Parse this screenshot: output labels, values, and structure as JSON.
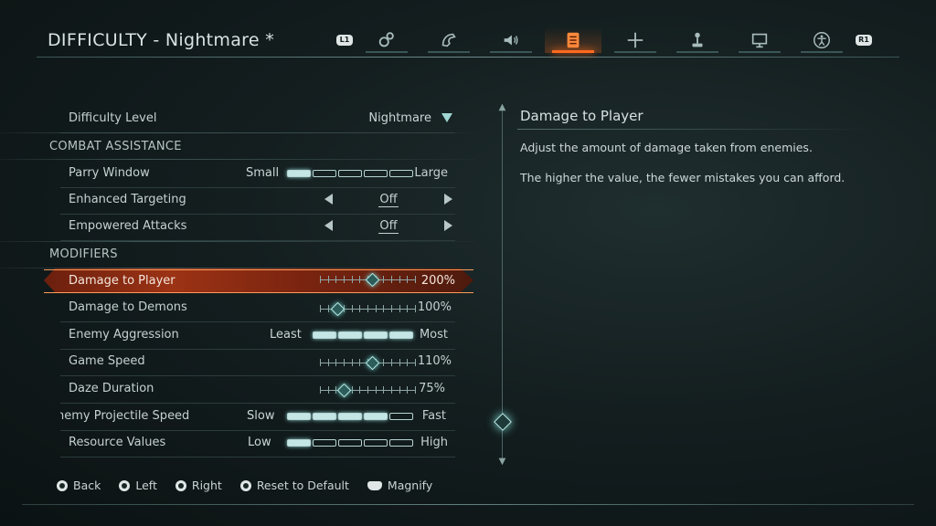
{
  "header": {
    "title": "DIFFICULTY - Nightmare *",
    "left_bumper": "L1",
    "right_bumper": "R1",
    "tabs": [
      {
        "name": "gameplay-tab",
        "icon": "gears-icon",
        "active": false
      },
      {
        "name": "controls-tab",
        "icon": "dragon-icon",
        "active": false
      },
      {
        "name": "audio-tab",
        "icon": "speaker-icon",
        "active": false
      },
      {
        "name": "difficulty-tab",
        "icon": "list-icon",
        "active": true
      },
      {
        "name": "movement-tab",
        "icon": "crosshair-move-icon",
        "active": false
      },
      {
        "name": "controller-tab",
        "icon": "joystick-icon",
        "active": false
      },
      {
        "name": "display-tab",
        "icon": "monitor-icon",
        "active": false
      },
      {
        "name": "accessibility-tab",
        "icon": "accessibility-icon",
        "active": false
      }
    ]
  },
  "difficulty_level": {
    "label": "Difficulty Level",
    "value": "Nightmare"
  },
  "sections": {
    "combat_assistance": "COMBAT ASSISTANCE",
    "modifiers": "MODIFIERS"
  },
  "settings": {
    "parry_window": {
      "label": "Parry Window",
      "min_label": "Small",
      "max_label": "Large",
      "level": 1,
      "segments": 5
    },
    "enhanced_targeting": {
      "label": "Enhanced Targeting",
      "value": "Off"
    },
    "empowered_attacks": {
      "label": "Empowered Attacks",
      "value": "Off"
    },
    "damage_to_player": {
      "label": "Damage to Player",
      "value": "200%",
      "fraction": 0.55
    },
    "damage_to_demons": {
      "label": "Damage to Demons",
      "value": "100%",
      "fraction": 0.18
    },
    "enemy_aggression": {
      "label": "Enemy Aggression",
      "min_label": "Least",
      "max_label": "Most",
      "level": 4,
      "segments": 4
    },
    "game_speed": {
      "label": "Game Speed",
      "value": "110%",
      "fraction": 0.55
    },
    "daze_duration": {
      "label": "Daze Duration",
      "value": "75%",
      "fraction": 0.25
    },
    "enemy_projectile_speed": {
      "label": "nemy Projectile Speed",
      "min_label": "Slow",
      "max_label": "Fast",
      "level": 4,
      "segments": 5
    },
    "resource_values": {
      "label": "Resource Values",
      "min_label": "Low",
      "max_label": "High",
      "level": 1,
      "segments": 5
    }
  },
  "detail": {
    "title": "Damage to Player",
    "line1": "Adjust the amount of damage taken from enemies.",
    "line2": "The higher the value, the fewer mistakes you can afford."
  },
  "footer": {
    "back": "Back",
    "left": "Left",
    "right": "Right",
    "reset": "Reset to Default",
    "magnify": "Magnify"
  },
  "colors": {
    "accent": "#ff6a1e",
    "teal_glow": "#8fd1cf"
  }
}
